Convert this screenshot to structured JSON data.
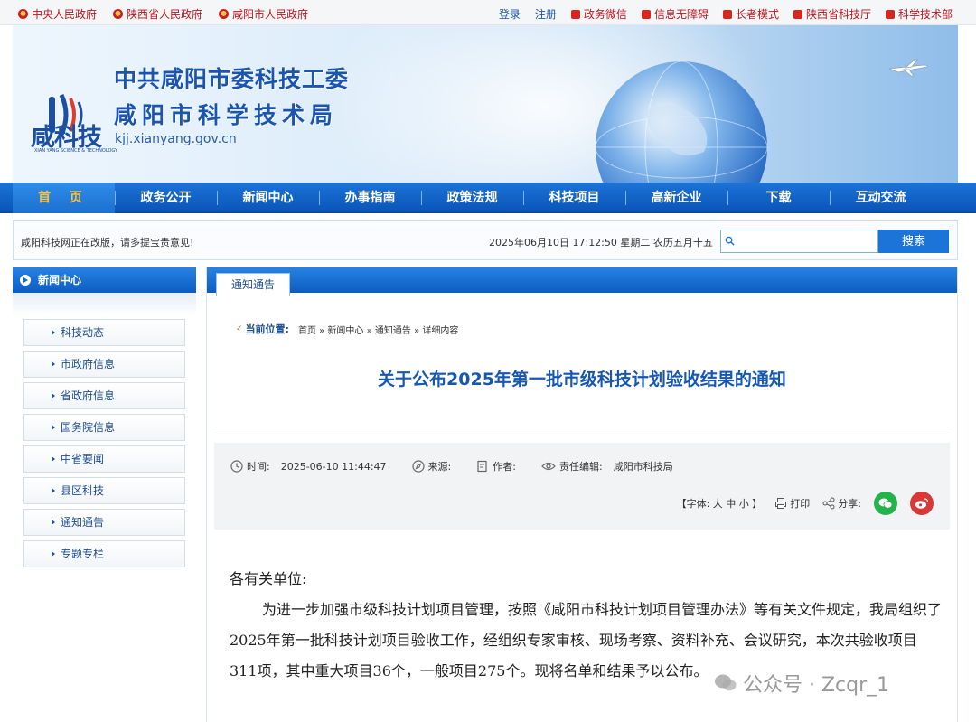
{
  "topbar": {
    "left_links": [
      "中央人民政府",
      "陕西省人民政府",
      "咸阳市人民政府"
    ],
    "right_plain": [
      "登录",
      "注册"
    ],
    "right_links": [
      "政务微信",
      "信息无障碍",
      "长者模式",
      "陕西省科技厅",
      "科学技术部"
    ]
  },
  "banner": {
    "logo_text": "咸科技",
    "logo_subtext": "XIAN YANG SCIENCE & TECHNOLOGY",
    "title_line1": "中共咸阳市委科技工委",
    "title_line2": "咸阳市科学技术局",
    "domain": "kjj.xianyang.gov.cn"
  },
  "nav": {
    "items": [
      "首 页",
      "政务公开",
      "新闻中心",
      "办事指南",
      "政策法规",
      "科技项目",
      "高新企业",
      "下载",
      "互动交流"
    ]
  },
  "infobar": {
    "notice": "咸阳科技网正在改版，请多提宝贵意见!",
    "datetime": "2025年06月10日 17:12:50 星期二 农历五月十五",
    "search_button": "搜索"
  },
  "sidebar": {
    "heading": "新闻中心",
    "items": [
      "科技动态",
      "市政府信息",
      "省政府信息",
      "国务院信息",
      "中省要闻",
      "县区科技",
      "通知通告",
      "专题专栏"
    ]
  },
  "main": {
    "tab": "通知通告",
    "breadcrumb": {
      "label": "当前位置:",
      "path": "首页 » 新闻中心 » 通知通告 » 详细内容"
    },
    "title": "关于公布2025年第一批市级科技计划验收结果的通知",
    "meta": {
      "time_label": "时间:",
      "time_value": "2025-06-10 11:44:47",
      "source_label": "来源:",
      "author_label": "作者:",
      "editor_label": "责任编辑:",
      "editor_value": "咸阳市科技局",
      "font_size": "【字体: 大 中 小 】",
      "print": "打印",
      "share": "分享:"
    },
    "body": {
      "salutation": "各有关单位:",
      "paragraph": "为进一步加强市级科技计划项目管理，按照《咸阳市科技计划项目管理办法》等有关文件规定，我局组织了2025年第一批科技计划项目验收工作，经组织专家审核、现场考察、资料补充、会议研究，本次共验收项目311项，其中重大项目36个，一般项目275个。现将名单和结果予以公布。"
    }
  },
  "watermark": "公众号 · Zcqr_1",
  "colors": {
    "nav_blue": "#0a55b8",
    "title_blue": "#1657b5",
    "gov_red": "#c0151b",
    "wechat_green": "#24b34a",
    "weibo_red": "#d93838"
  }
}
